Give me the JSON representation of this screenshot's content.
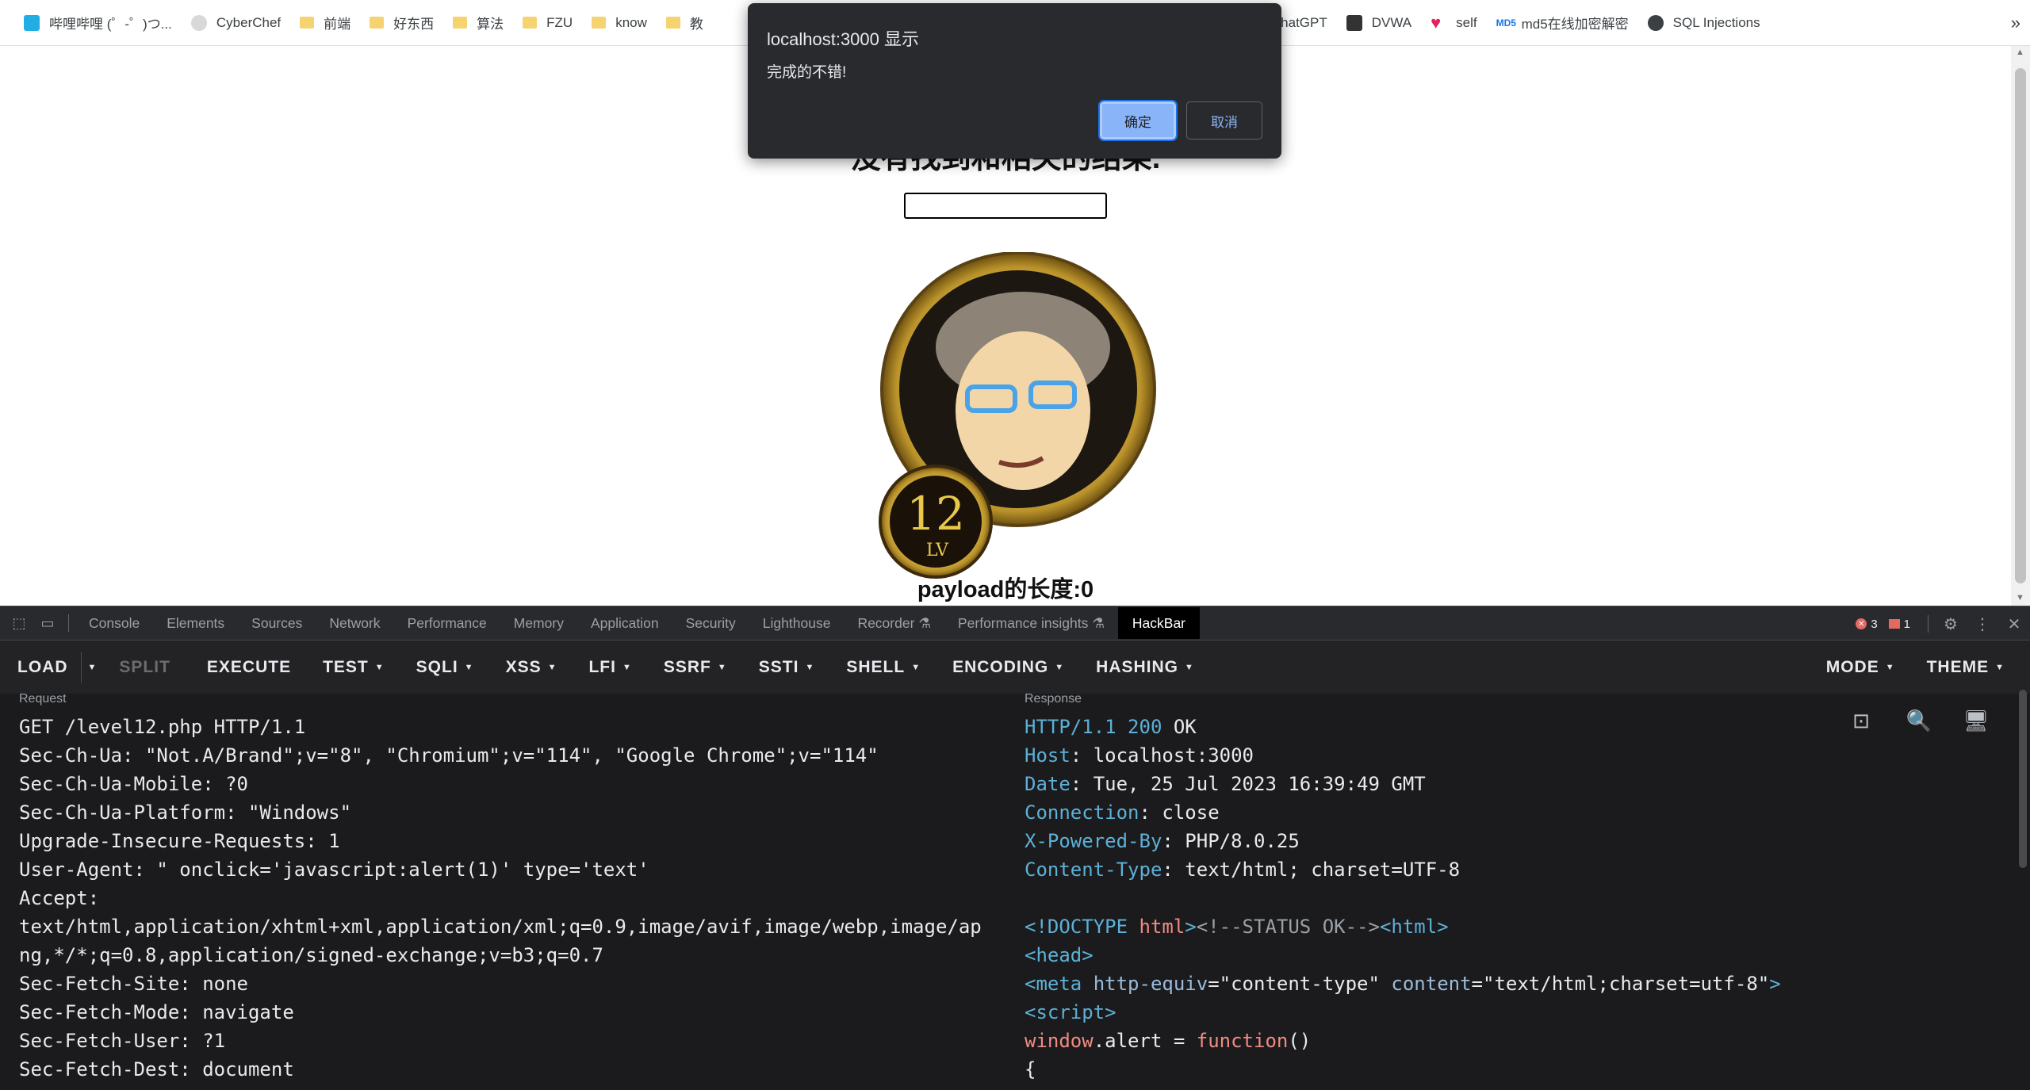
{
  "bookmarks": [
    {
      "label": "哔哩哔哩 (゜-゜)つ...",
      "icon": "bilibili-icon"
    },
    {
      "label": "CyberChef",
      "icon": "cyberchef-icon"
    },
    {
      "label": "前端",
      "icon": "folder-icon"
    },
    {
      "label": "好东西",
      "icon": "folder-icon"
    },
    {
      "label": "算法",
      "icon": "folder-icon"
    },
    {
      "label": "FZU",
      "icon": "folder-icon"
    },
    {
      "label": "know",
      "icon": "folder-icon"
    },
    {
      "label": "教",
      "icon": "folder-icon"
    },
    {
      "label": "ChatGPT",
      "icon": "chatgpt-icon"
    },
    {
      "label": "DVWA",
      "icon": "dvwa-icon"
    },
    {
      "label": "self",
      "icon": "heart-icon"
    },
    {
      "label": "md5在线加密解密",
      "icon": "md5-icon"
    },
    {
      "label": "SQL Injections",
      "icon": "globe-icon"
    }
  ],
  "bookmarks_more": "»",
  "dialog": {
    "title": "localhost:3000 显示",
    "message": "完成的不错!",
    "ok": "确定",
    "cancel": "取消"
  },
  "page": {
    "heading": "没有找到和相关的结果.",
    "input_value": "",
    "badge_number": "12",
    "badge_suffix": "LV",
    "payload_length": "payload的长度:0"
  },
  "devtools": {
    "tabs": [
      "Console",
      "Elements",
      "Sources",
      "Network",
      "Performance",
      "Memory",
      "Application",
      "Security",
      "Lighthouse",
      "Recorder ⚗",
      "Performance insights ⚗",
      "HackBar"
    ],
    "active_tab": "HackBar",
    "errors": "3",
    "warnings": "1"
  },
  "hackbar": {
    "buttons": [
      {
        "label": "LOAD",
        "caret": false
      },
      {
        "label": "SPLIT",
        "caret": false,
        "dim": true
      },
      {
        "label": "EXECUTE",
        "caret": false
      },
      {
        "label": "TEST",
        "caret": true
      },
      {
        "label": "SQLI",
        "caret": true
      },
      {
        "label": "XSS",
        "caret": true
      },
      {
        "label": "LFI",
        "caret": true
      },
      {
        "label": "SSRF",
        "caret": true
      },
      {
        "label": "SSTI",
        "caret": true
      },
      {
        "label": "SHELL",
        "caret": true
      },
      {
        "label": "ENCODING",
        "caret": true
      },
      {
        "label": "HASHING",
        "caret": true
      }
    ],
    "right_buttons": [
      {
        "label": "MODE",
        "caret": true
      },
      {
        "label": "THEME",
        "caret": true
      }
    ],
    "request_label": "Request",
    "response_label": "Response",
    "request_lines": [
      "GET /level12.php HTTP/1.1",
      "Sec-Ch-Ua: \"Not.A/Brand\";v=\"8\", \"Chromium\";v=\"114\", \"Google Chrome\";v=\"114\"",
      "Sec-Ch-Ua-Mobile: ?0",
      "Sec-Ch-Ua-Platform: \"Windows\"",
      "Upgrade-Insecure-Requests: 1",
      "User-Agent: \" onclick='javascript:alert(1)' type='text'",
      "Accept:",
      "text/html,application/xhtml+xml,application/xml;q=0.9,image/avif,image/webp,image/ap",
      "ng,*/*;q=0.8,application/signed-exchange;v=b3;q=0.7",
      "Sec-Fetch-Site: none",
      "Sec-Fetch-Mode: navigate",
      "Sec-Fetch-User: ?1",
      "Sec-Fetch-Dest: document"
    ],
    "response_status": {
      "protocol": "HTTP/1.1",
      "code": "200",
      "text": "OK"
    },
    "response_headers": [
      {
        "name": "Host",
        "value": "localhost:3000"
      },
      {
        "name": "Date",
        "value": "Tue, 25 Jul 2023 16:39:49 GMT"
      },
      {
        "name": "Connection",
        "value": "close"
      },
      {
        "name": "X-Powered-By",
        "value": "PHP/8.0.25"
      },
      {
        "name": "Content-Type",
        "value": "text/html; charset=UTF-8"
      }
    ],
    "response_body": {
      "doctype_open": "<!DOCTYPE",
      "doctype_html": " html",
      "doctype_close": ">",
      "comment": "<!--STATUS OK-->",
      "html_tag": "<html>",
      "head_tag": "<head>",
      "meta_open": "<meta",
      "meta_attr1": " http-equiv",
      "meta_val1": "=\"content-type\"",
      "meta_attr2": " content",
      "meta_val2": "=\"text/html;charset=utf-8\"",
      "meta_close": ">",
      "script_tag": "<script>",
      "window_alert": "window",
      "dot_alert": ".alert = ",
      "function_kw": "function",
      "parens": "()",
      "brace": "{"
    }
  }
}
